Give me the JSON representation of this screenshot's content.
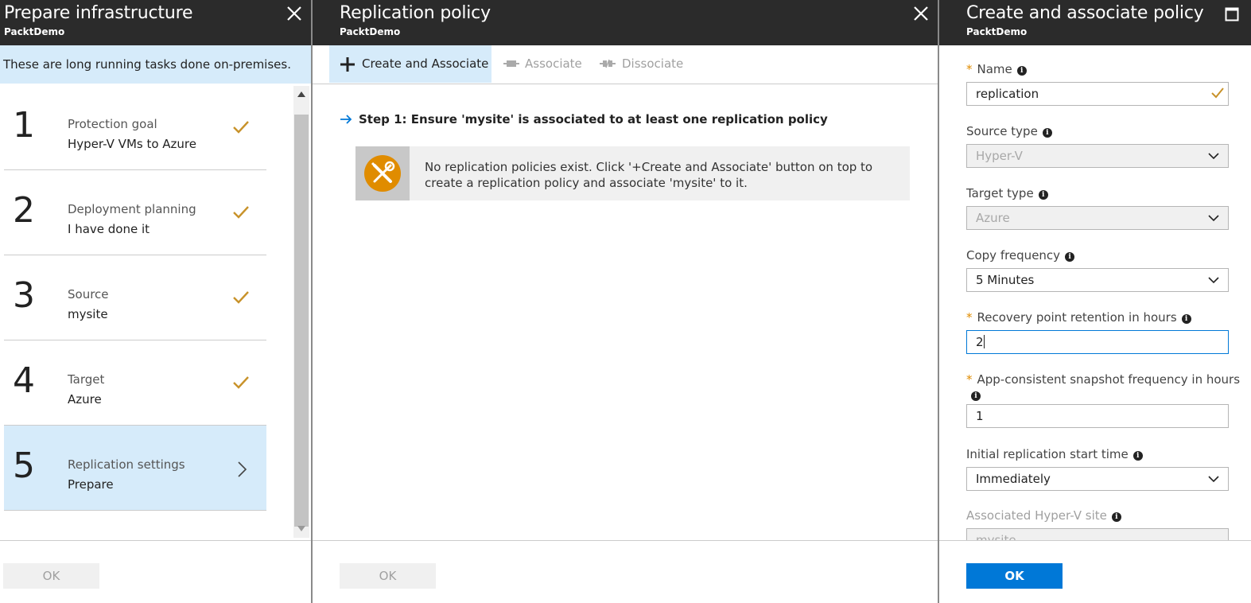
{
  "blade1": {
    "title": "Prepare infrastructure",
    "subtitle": "PacktDemo",
    "banner": "These are long running tasks done on-premises.",
    "steps": [
      {
        "number": "1",
        "title": "Protection goal",
        "value": "Hyper-V VMs to Azure",
        "status": "done"
      },
      {
        "number": "2",
        "title": "Deployment planning",
        "value": "I have done it",
        "status": "done"
      },
      {
        "number": "3",
        "title": "Source",
        "value": "mysite",
        "status": "done"
      },
      {
        "number": "4",
        "title": "Target",
        "value": "Azure",
        "status": "done"
      },
      {
        "number": "5",
        "title": "Replication settings",
        "value": "Prepare",
        "status": "selected"
      }
    ],
    "ok_label": "OK"
  },
  "blade2": {
    "title": "Replication policy",
    "subtitle": "PacktDemo",
    "toolbar": {
      "create_associate": "Create and Associate",
      "associate": "Associate",
      "dissociate": "Dissociate"
    },
    "step_text": "Step 1: Ensure 'mysite' is associated to at least one replication policy",
    "notice": "No replication policies exist. Click '+Create and Associate' button on top to create a replication policy and associate 'mysite' to it.",
    "ok_label": "OK"
  },
  "blade3": {
    "title": "Create and associate policy",
    "subtitle": "PacktDemo",
    "fields": {
      "name": {
        "label": "Name",
        "value": "replication",
        "required": true
      },
      "source_type": {
        "label": "Source type",
        "value": "Hyper-V"
      },
      "target_type": {
        "label": "Target type",
        "value": "Azure"
      },
      "copy_frequency": {
        "label": "Copy frequency",
        "value": "5 Minutes"
      },
      "recovery_retention": {
        "label": "Recovery point retention in hours",
        "value": "2",
        "required": true
      },
      "app_snapshot": {
        "label": "App-consistent snapshot frequency in hours",
        "value": "1",
        "required": true
      },
      "initial_start": {
        "label": "Initial replication start time",
        "value": "Immediately"
      },
      "hyperv_site": {
        "label": "Associated Hyper-V site",
        "value": "mysite"
      }
    },
    "ok_label": "OK"
  },
  "colors": {
    "header_bg": "#2b2b2b",
    "selection_bg": "#d6ebfa",
    "accent": "#0078d7",
    "check": "#c8922a",
    "required": "#e08c00"
  }
}
